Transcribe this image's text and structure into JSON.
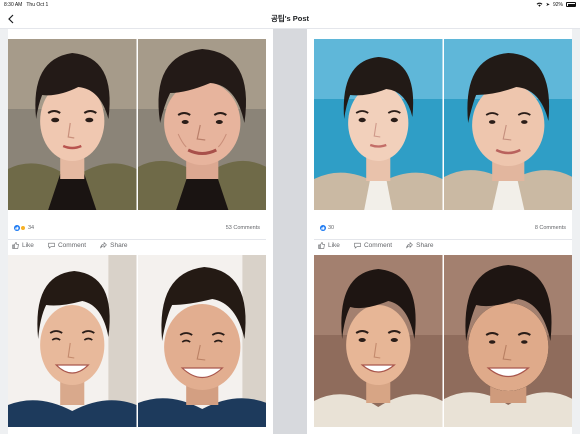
{
  "status": {
    "time": "8:30 AM",
    "date": "Thu Oct 1",
    "battery": "92%"
  },
  "nav": {
    "title": "공팁's Post"
  },
  "posts": [
    {
      "reaction_count": "34",
      "comments": "53 Comments",
      "actions": {
        "like": "Like",
        "comment": "Comment",
        "share": "Share"
      }
    },
    {
      "reaction_count": "30",
      "comments": "8 Comments",
      "actions": {
        "like": "Like",
        "comment": "Comment",
        "share": "Share"
      }
    }
  ],
  "colors": {
    "accent": "#1877f2",
    "gutter": "#d7d9dd",
    "meta": "#65676b"
  }
}
